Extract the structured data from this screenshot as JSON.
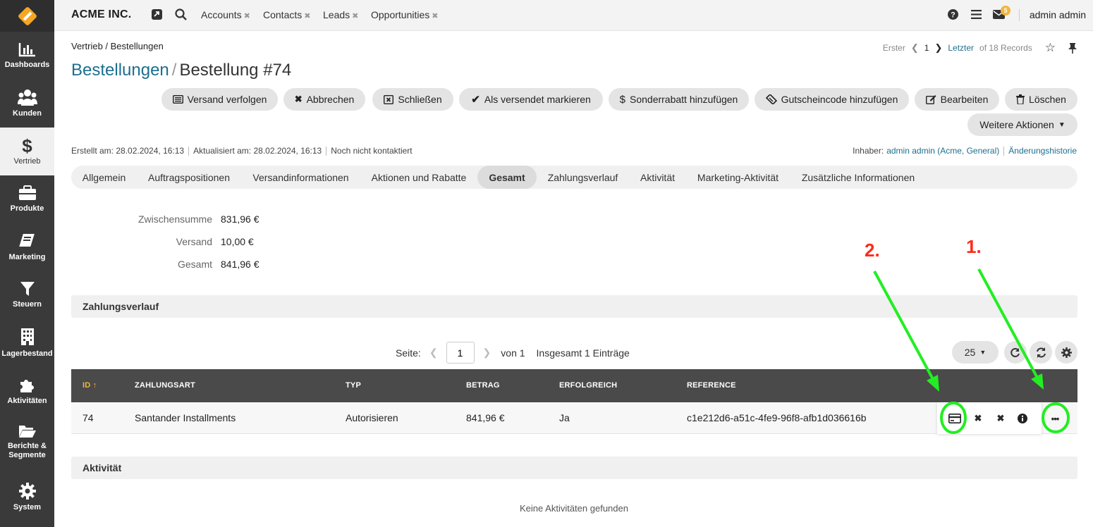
{
  "sidebar": {
    "items": [
      {
        "label": "Dashboards"
      },
      {
        "label": "Kunden"
      },
      {
        "label": "Vertrieb"
      },
      {
        "label": "Produkte"
      },
      {
        "label": "Marketing"
      },
      {
        "label": "Steuern"
      },
      {
        "label": "Lagerbestand"
      },
      {
        "label": "Aktivitäten"
      },
      {
        "label": "Berichte & Segmente"
      },
      {
        "label": "System"
      }
    ]
  },
  "topbar": {
    "company": "ACME INC.",
    "tabs": [
      {
        "label": "Accounts"
      },
      {
        "label": "Contacts"
      },
      {
        "label": "Leads"
      },
      {
        "label": "Opportunities"
      }
    ],
    "notification_count": "5",
    "user": "admin admin"
  },
  "breadcrumb": "Vertrieb / Bestellungen",
  "pager": {
    "first": "Erster",
    "current": "1",
    "last": "Letzter",
    "records": "of 18 Records"
  },
  "title": {
    "parent": "Bestellungen",
    "separator": "/",
    "current": "Bestellung #74"
  },
  "actions": [
    {
      "label": "Versand verfolgen"
    },
    {
      "label": "Abbrechen"
    },
    {
      "label": "Schließen"
    },
    {
      "label": "Als versendet markieren"
    },
    {
      "label": "Sonderrabatt hinzufügen"
    },
    {
      "label": "Gutscheincode hinzufügen"
    },
    {
      "label": "Bearbeiten"
    },
    {
      "label": "Löschen"
    }
  ],
  "more_actions": "Weitere Aktionen",
  "meta": {
    "created": "Erstellt am: 28.02.2024, 16:13",
    "updated": "Aktualisiert am: 28.02.2024, 16:13",
    "contacted": "Noch nicht kontaktiert",
    "owner_label": "Inhaber:",
    "owner_value": "admin admin (Acme, General)",
    "history": "Änderungshistorie"
  },
  "tabs": [
    {
      "label": "Allgemein"
    },
    {
      "label": "Auftragspositionen"
    },
    {
      "label": "Versandinformationen"
    },
    {
      "label": "Aktionen und Rabatte"
    },
    {
      "label": "Gesamt",
      "active": true
    },
    {
      "label": "Zahlungsverlauf"
    },
    {
      "label": "Aktivität"
    },
    {
      "label": "Marketing-Aktivität"
    },
    {
      "label": "Zusätzliche Informationen"
    }
  ],
  "summary": [
    {
      "label": "Zwischensumme",
      "value": "831,96 €"
    },
    {
      "label": "Versand",
      "value": "10,00 €"
    },
    {
      "label": "Gesamt",
      "value": "841,96 €"
    }
  ],
  "payment_section": {
    "title": "Zahlungsverlauf",
    "page_label": "Seite:",
    "page_value": "1",
    "of_pages": "von 1",
    "total": "Insgesamt 1 Einträge",
    "per_page": "25",
    "columns": [
      "ID",
      "ZAHLUNGSART",
      "TYP",
      "BETRAG",
      "ERFOLGREICH",
      "REFERENCE"
    ],
    "rows": [
      {
        "id": "74",
        "method": "Santander Installments",
        "type": "Autorisieren",
        "amount": "841,96 €",
        "success": "Ja",
        "reference": "c1e212d6-a51c-4fe9-96f8-afb1d036616b"
      }
    ]
  },
  "activity_section": {
    "title": "Aktivität",
    "empty": "Keine Aktivitäten gefunden"
  },
  "annotations": [
    "2.",
    "1."
  ],
  "colors": {
    "sidebar": "#3a3a3a",
    "link": "#1c6f8f",
    "annotation_green": "#22ee22",
    "annotation_red": "#ff2a1a",
    "sort_accent": "#f2b63a"
  }
}
